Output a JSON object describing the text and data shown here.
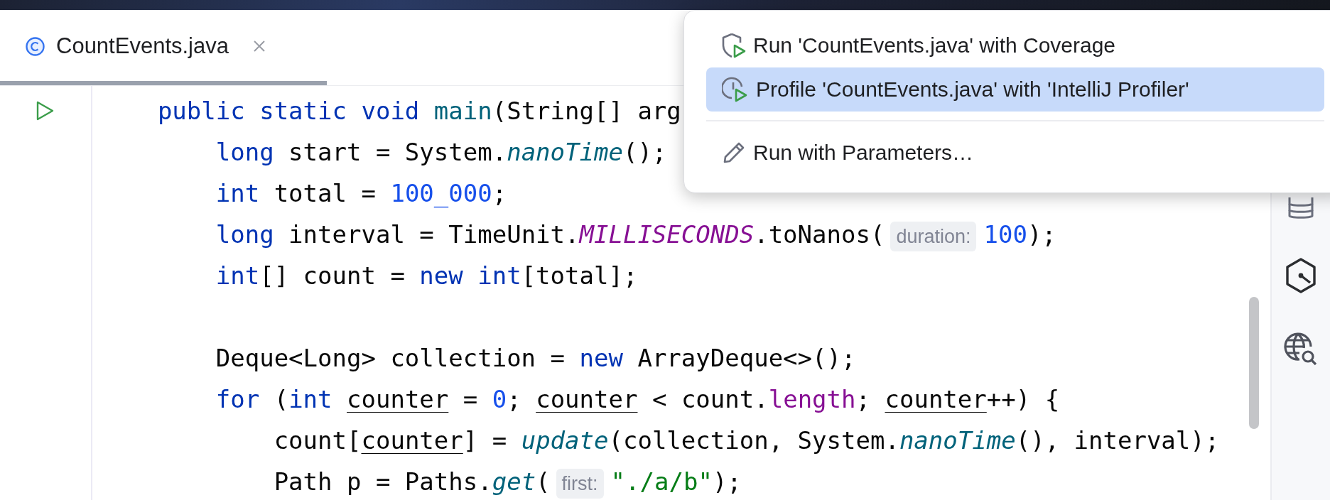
{
  "tab": {
    "label": "CountEvents.java",
    "selected": true
  },
  "code_lines": [
    {
      "run_marker": true,
      "blank_before": false,
      "tokens": [
        {
          "kind": "keyword",
          "text": "    public static void "
        },
        {
          "kind": "method",
          "text": "main"
        },
        {
          "kind": "plain",
          "text": "(String[] arg"
        }
      ]
    },
    {
      "run_marker": false,
      "blank_before": false,
      "tokens": [
        {
          "kind": "keyword",
          "text": "        long"
        },
        {
          "kind": "plain",
          "text": " start = System."
        },
        {
          "kind": "static_method",
          "text": "nanoTime"
        },
        {
          "kind": "plain",
          "text": "();"
        }
      ]
    },
    {
      "run_marker": false,
      "blank_before": false,
      "tokens": [
        {
          "kind": "keyword",
          "text": "        int"
        },
        {
          "kind": "plain",
          "text": " total = "
        },
        {
          "kind": "number",
          "text": "100_000"
        },
        {
          "kind": "plain",
          "text": ";"
        }
      ]
    },
    {
      "run_marker": false,
      "blank_before": false,
      "tokens": [
        {
          "kind": "keyword",
          "text": "        long"
        },
        {
          "kind": "plain",
          "text": " interval = TimeUnit."
        },
        {
          "kind": "constant",
          "text": "MILLISECONDS"
        },
        {
          "kind": "plain",
          "text": ".toNanos("
        },
        {
          "kind": "hint",
          "text": "duration:"
        },
        {
          "kind": "number",
          "text": "100"
        },
        {
          "kind": "plain",
          "text": ");"
        }
      ]
    },
    {
      "run_marker": false,
      "blank_before": false,
      "tokens": [
        {
          "kind": "keyword",
          "text": "        int"
        },
        {
          "kind": "plain",
          "text": "[] count = "
        },
        {
          "kind": "keyword",
          "text": "new int"
        },
        {
          "kind": "plain",
          "text": "[total];"
        }
      ]
    },
    {
      "run_marker": false,
      "blank_before": true,
      "tokens": [
        {
          "kind": "plain",
          "text": "        Deque<Long> collection = "
        },
        {
          "kind": "keyword",
          "text": "new"
        },
        {
          "kind": "plain",
          "text": " ArrayDeque<>();"
        }
      ]
    },
    {
      "run_marker": false,
      "blank_before": false,
      "tokens": [
        {
          "kind": "keyword",
          "text": "        for"
        },
        {
          "kind": "plain",
          "text": " ("
        },
        {
          "kind": "keyword",
          "text": "int "
        },
        {
          "kind": "reassigned",
          "text": "counter"
        },
        {
          "kind": "plain",
          "text": " = "
        },
        {
          "kind": "number",
          "text": "0"
        },
        {
          "kind": "plain",
          "text": "; "
        },
        {
          "kind": "reassigned",
          "text": "counter"
        },
        {
          "kind": "plain",
          "text": " < count."
        },
        {
          "kind": "field",
          "text": "length"
        },
        {
          "kind": "plain",
          "text": "; "
        },
        {
          "kind": "reassigned",
          "text": "counter"
        },
        {
          "kind": "plain",
          "text": "++) {"
        }
      ]
    },
    {
      "run_marker": false,
      "blank_before": false,
      "tokens": [
        {
          "kind": "plain",
          "text": "            count["
        },
        {
          "kind": "reassigned",
          "text": "counter"
        },
        {
          "kind": "plain",
          "text": "] = "
        },
        {
          "kind": "static_method",
          "text": "update"
        },
        {
          "kind": "plain",
          "text": "(collection, System."
        },
        {
          "kind": "static_method",
          "text": "nanoTime"
        },
        {
          "kind": "plain",
          "text": "(), interval);"
        }
      ]
    },
    {
      "run_marker": false,
      "blank_before": false,
      "tokens": [
        {
          "kind": "plain",
          "text": "            Path p = Paths."
        },
        {
          "kind": "static_method",
          "text": "get"
        },
        {
          "kind": "plain",
          "text": "("
        },
        {
          "kind": "hint",
          "text": "first:"
        },
        {
          "kind": "string",
          "text": "\"./a/b\""
        },
        {
          "kind": "plain",
          "text": ");"
        }
      ]
    }
  ],
  "popup_menu": {
    "items": [
      {
        "kind": "coverage",
        "label": "Run 'CountEvents.java' with Coverage",
        "selected": false,
        "separator_before": false
      },
      {
        "kind": "profile",
        "label": "Profile 'CountEvents.java' with 'IntelliJ Profiler'",
        "selected": true,
        "separator_before": false
      },
      {
        "kind": "parameters",
        "label": "Run with Parameters…",
        "selected": false,
        "separator_before": true
      }
    ]
  }
}
